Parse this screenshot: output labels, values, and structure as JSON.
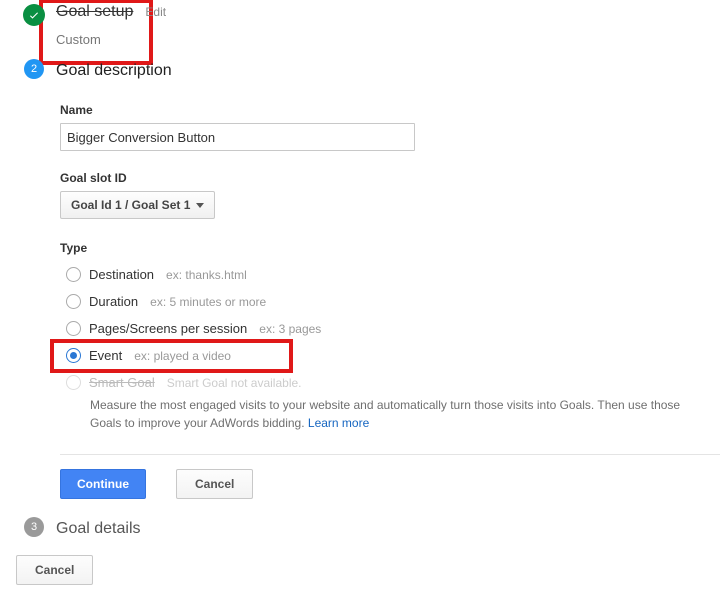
{
  "step1": {
    "title": "Goal setup",
    "edit": "Edit",
    "subtitle": "Custom"
  },
  "step2": {
    "number": "2",
    "title": "Goal description",
    "name_label": "Name",
    "name_value": "Bigger Conversion Button",
    "slot_label": "Goal slot ID",
    "slot_value": "Goal Id 1 / Goal Set 1",
    "type_label": "Type",
    "types": {
      "destination": {
        "label": "Destination",
        "hint": "ex: thanks.html"
      },
      "duration": {
        "label": "Duration",
        "hint": "ex: 5 minutes or more"
      },
      "pages": {
        "label": "Pages/Screens per session",
        "hint": "ex: 3 pages"
      },
      "event": {
        "label": "Event",
        "hint": "ex: played a video"
      },
      "smart": {
        "label": "Smart Goal",
        "hint": "Smart Goal not available."
      }
    },
    "smart_desc": "Measure the most engaged visits to your website and automatically turn those visits into Goals. Then use those Goals to improve your AdWords bidding. ",
    "learn_more": "Learn more",
    "continue": "Continue",
    "cancel": "Cancel"
  },
  "step3": {
    "number": "3",
    "title": "Goal details"
  },
  "footer": {
    "cancel": "Cancel"
  }
}
